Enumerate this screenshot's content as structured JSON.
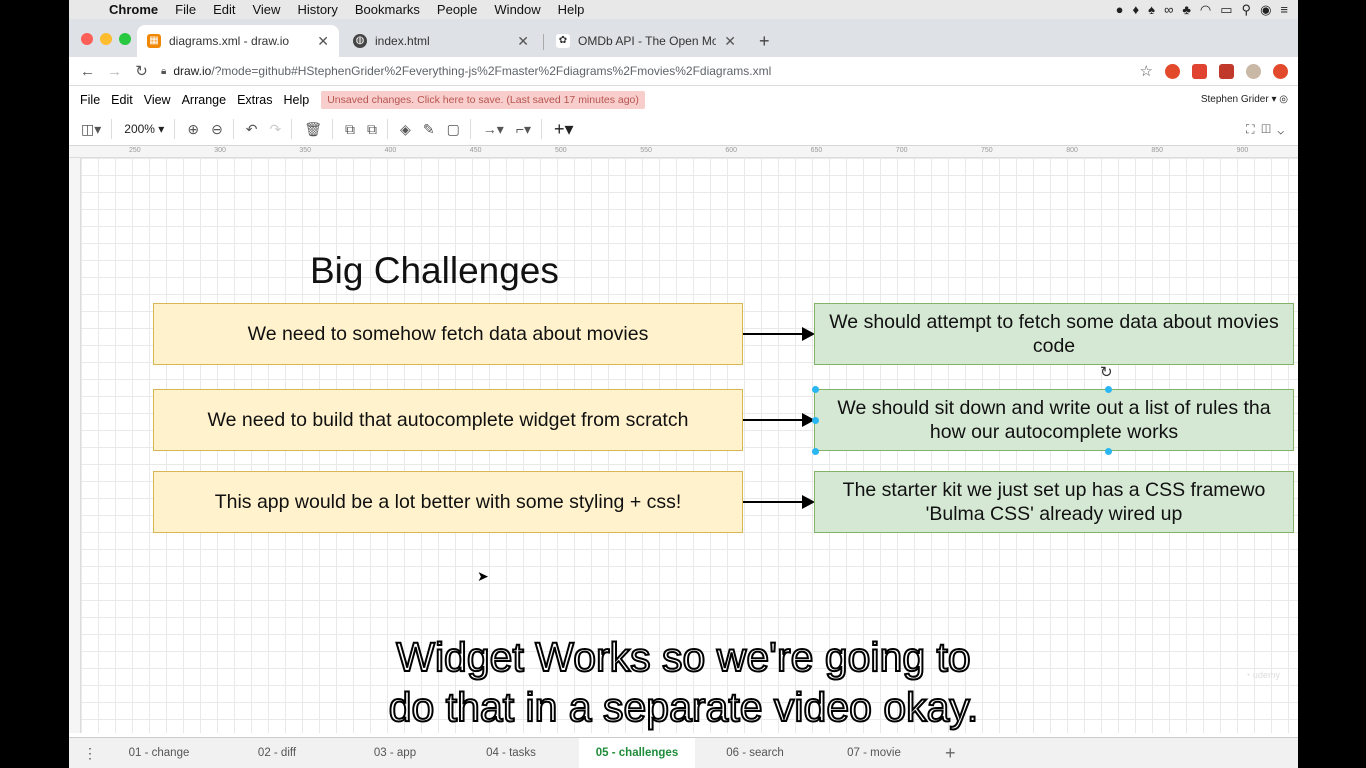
{
  "mac_menu": {
    "app": "Chrome",
    "items": [
      "File",
      "Edit",
      "View",
      "History",
      "Bookmarks",
      "People",
      "Window",
      "Help"
    ]
  },
  "tabs": [
    {
      "title": "diagrams.xml - draw.io",
      "icon": "drawio-icon",
      "active": true
    },
    {
      "title": "index.html",
      "icon": "globe-icon",
      "active": false
    },
    {
      "title": "OMDb API - The Open Movie D",
      "icon": "omdb-icon",
      "active": false
    }
  ],
  "address": {
    "host": "draw.io",
    "path": "/?mode=github#HStephenGrider%2Feverything-js%2Fmaster%2Fdiagrams%2Fmovies%2Fdiagrams.xml"
  },
  "drawio_menu": {
    "items": [
      "File",
      "Edit",
      "View",
      "Arrange",
      "Extras",
      "Help"
    ],
    "warning": "Unsaved changes. Click here to save. (Last saved 17 minutes ago)",
    "user": "Stephen Grider"
  },
  "toolbar": {
    "zoom": "200%"
  },
  "ruler": {
    "ticks": [
      "250",
      "300",
      "350",
      "400",
      "450",
      "500",
      "550",
      "600",
      "650",
      "700",
      "750",
      "800",
      "850",
      "900"
    ]
  },
  "diagram": {
    "title": "Big Challenges",
    "problems": [
      "We need to somehow fetch data about movies",
      "We need to build that autocomplete widget from scratch",
      "This app would be a lot better with some styling + css!"
    ],
    "solutions": [
      [
        "We should attempt to fetch some data about movies",
        "code"
      ],
      [
        "We should sit down and write out a list of rules tha",
        "how our autocomplete works"
      ],
      [
        "The starter kit we just set up has a CSS framewo",
        "'Bulma CSS' already wired up"
      ]
    ]
  },
  "caption": [
    "Widget Works so we're going to",
    "do that in a separate video okay."
  ],
  "pages": [
    "01 - change",
    "02 - diff",
    "03 - app",
    "04 - tasks",
    "05 - challenges",
    "06 - search",
    "07 - movie"
  ],
  "active_page": "05 - challenges",
  "colors": {
    "problem_fill": "#fff2cc",
    "problem_border": "#d6b656",
    "solution_fill": "#d5e8d4",
    "solution_border": "#82b366",
    "active_page": "#1e8c3a",
    "warning_bg": "#f8cecc"
  }
}
